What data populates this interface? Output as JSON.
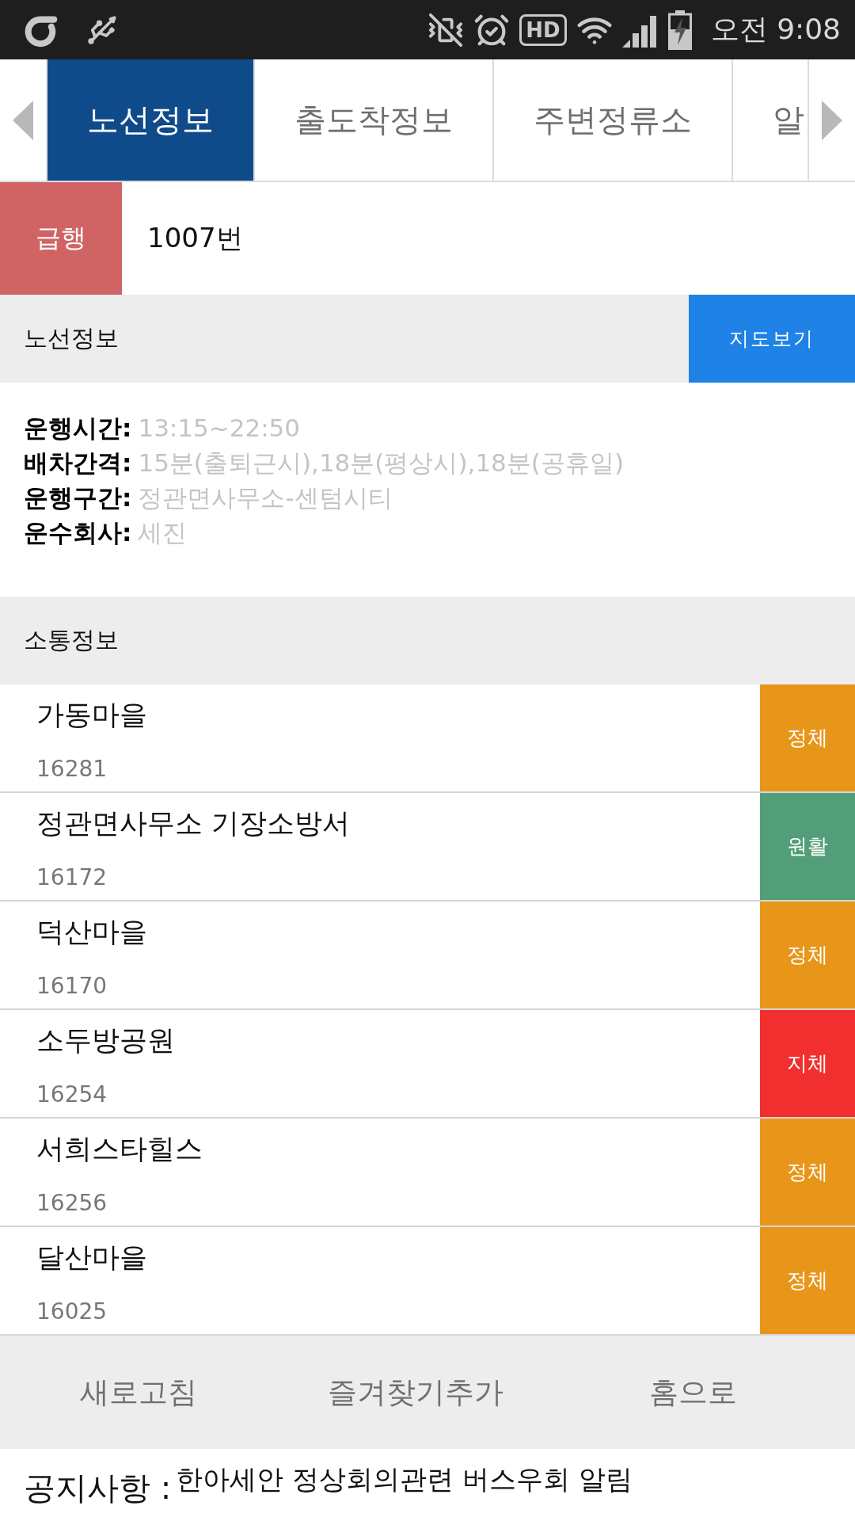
{
  "status_bar": {
    "hd_label": "HD",
    "time": "오전 9:08"
  },
  "tabs": [
    {
      "label": "노선정보",
      "selected": true
    },
    {
      "label": "출도착정보",
      "selected": false
    },
    {
      "label": "주변정류소",
      "selected": false
    },
    {
      "label": "알",
      "selected": false
    }
  ],
  "route": {
    "type_badge": "급행",
    "number": "1007번"
  },
  "route_info": {
    "title": "노선정보",
    "map_button": "지도보기",
    "rows": [
      {
        "label": "운행시간:",
        "value": "13:15~22:50"
      },
      {
        "label": "배차간격:",
        "value": "15분(출퇴근시),18분(평상시),18분(공휴일)"
      },
      {
        "label": "운행구간:",
        "value": "정관면사무소-센텀시티"
      },
      {
        "label": "운수회사:",
        "value": "세진"
      }
    ]
  },
  "traffic": {
    "title": "소통정보",
    "stops": [
      {
        "name": "가동마을",
        "number": "16281",
        "status": "정체",
        "color": "#e8961a"
      },
      {
        "name": "정관면사무소 기장소방서",
        "number": "16172",
        "status": "원활",
        "color": "#529e78"
      },
      {
        "name": "덕산마을",
        "number": "16170",
        "status": "정체",
        "color": "#e8961a"
      },
      {
        "name": "소두방공원",
        "number": "16254",
        "status": "지체",
        "color": "#f22f2f"
      },
      {
        "name": "서희스타힐스",
        "number": "16256",
        "status": "정체",
        "color": "#e8961a"
      },
      {
        "name": "달산마을",
        "number": "16025",
        "status": "정체",
        "color": "#e8961a"
      }
    ]
  },
  "bottom_buttons": [
    "새로고침",
    "즐겨찾기추가",
    "홈으로"
  ],
  "notice": {
    "label": "공지사항 :",
    "text": "한아세안 정상회의관련 버스우회 알림"
  }
}
